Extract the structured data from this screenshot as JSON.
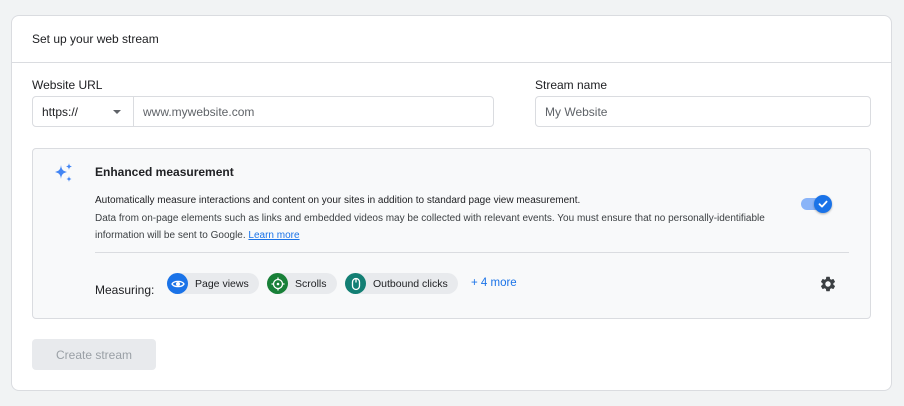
{
  "card": {
    "title": "Set up your web stream"
  },
  "website_url": {
    "label": "Website URL",
    "protocol": "https://",
    "placeholder": "www.mywebsite.com"
  },
  "stream_name": {
    "label": "Stream name",
    "placeholder": "My Website"
  },
  "enhanced": {
    "title": "Enhanced measurement",
    "description": "Automatically measure interactions and content on your sites in addition to standard page view measurement.",
    "note": "Data from on-page elements such as links and embedded videos may be collected with relevant events. You must ensure that no personally-identifiable information will be sent to Google.",
    "learn_more": "Learn more",
    "toggle_on": true,
    "measuring_label": "Measuring:",
    "chips": [
      {
        "label": "Page views",
        "icon": "eye-icon",
        "color": "#1a73e8"
      },
      {
        "label": "Scrolls",
        "icon": "scroll-crosshair-icon",
        "color": "#188038"
      },
      {
        "label": "Outbound clicks",
        "icon": "mouse-icon",
        "color": "#137f74"
      }
    ],
    "more": "+ 4 more"
  },
  "actions": {
    "create": "Create stream"
  }
}
